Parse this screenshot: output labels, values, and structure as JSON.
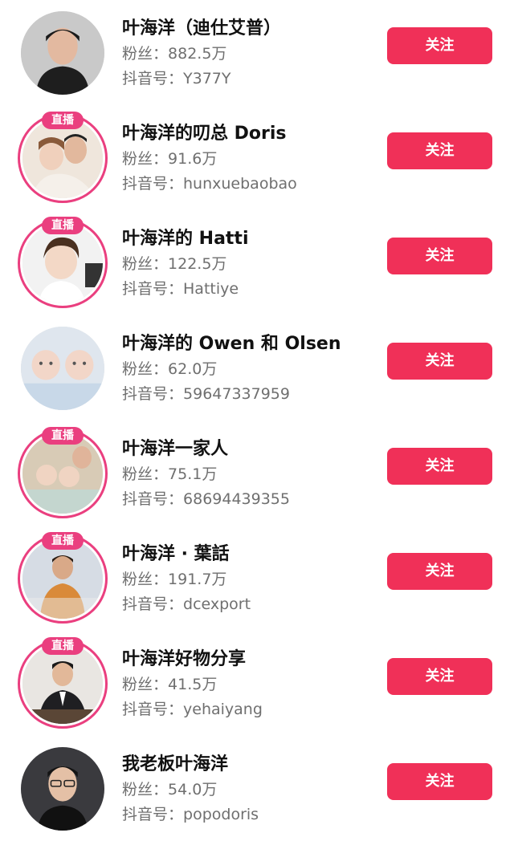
{
  "accounts": [
    {
      "name": "叶海洋（迪仕艾普）",
      "fans_label": "粉丝：",
      "fans": "882.5万",
      "id_label": "抖音号：",
      "id": "Y377Y",
      "live": false,
      "live_label": "",
      "follow_label": "关注",
      "avatar": "man-portrait"
    },
    {
      "name": "叶海洋的叨总 Doris",
      "fans_label": "粉丝：",
      "fans": "91.6万",
      "id_label": "抖音号：",
      "id": "hunxuebaobao",
      "live": true,
      "live_label": "直播",
      "follow_label": "关注",
      "avatar": "family-photo"
    },
    {
      "name": "叶海洋的 Hatti",
      "fans_label": "粉丝：",
      "fans": "122.5万",
      "id_label": "抖音号：",
      "id": "Hattiye",
      "live": true,
      "live_label": "直播",
      "follow_label": "关注",
      "avatar": "child-photo"
    },
    {
      "name": "叶海洋的 Owen 和 Olsen",
      "fans_label": "粉丝：",
      "fans": "62.0万",
      "id_label": "抖音号：",
      "id": "59647337959",
      "live": false,
      "live_label": "",
      "follow_label": "关注",
      "avatar": "twin-babies"
    },
    {
      "name": "叶海洋一家人",
      "fans_label": "粉丝：",
      "fans": "75.1万",
      "id_label": "抖音号：",
      "id": "68694439355",
      "live": true,
      "live_label": "直播",
      "follow_label": "关注",
      "avatar": "family-babies"
    },
    {
      "name": "叶海洋 · 葉話",
      "fans_label": "粉丝：",
      "fans": "191.7万",
      "id_label": "抖音号：",
      "id": "dcexport",
      "live": true,
      "live_label": "直播",
      "follow_label": "关注",
      "avatar": "man-orange-shirt"
    },
    {
      "name": "叶海洋好物分享",
      "fans_label": "粉丝：",
      "fans": "41.5万",
      "id_label": "抖音号：",
      "id": "yehaiyang",
      "live": true,
      "live_label": "直播",
      "follow_label": "关注",
      "avatar": "man-suit"
    },
    {
      "name": "我老板叶海洋",
      "fans_label": "粉丝：",
      "fans": "54.0万",
      "id_label": "抖音号：",
      "id": "popodoris",
      "live": false,
      "live_label": "",
      "follow_label": "关注",
      "avatar": "man-glasses"
    }
  ],
  "colors": {
    "follow_button": "#f03058",
    "live_ring": "#ea3f7f"
  }
}
